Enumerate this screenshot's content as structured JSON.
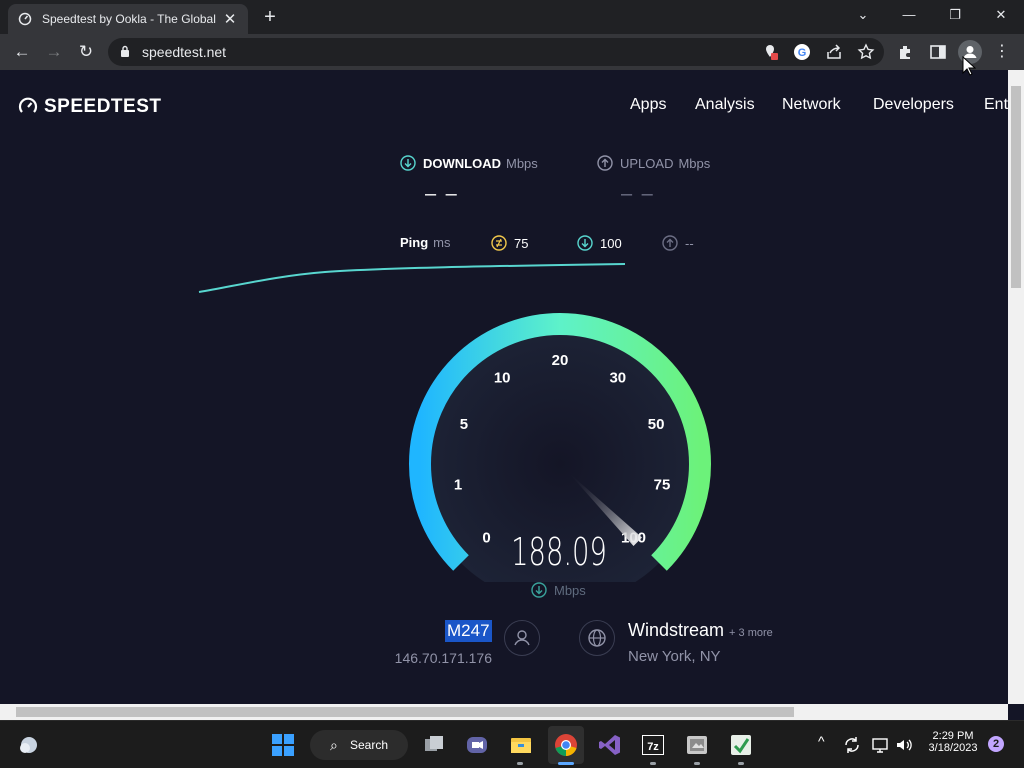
{
  "browser": {
    "tab_title": "Speedtest by Ookla - The Global",
    "url": "speedtest.net"
  },
  "site": {
    "logo_text": "SPEEDTEST",
    "nav": [
      "Apps",
      "Analysis",
      "Network",
      "Developers",
      "Ent"
    ]
  },
  "test": {
    "download_label": "DOWNLOAD",
    "upload_label": "UPLOAD",
    "unit": "Mbps",
    "download_value": "– –",
    "upload_value": "– –",
    "ping_label": "Ping",
    "ping_unit": "ms",
    "ping_idle": "75",
    "ping_down": "100",
    "ping_up": "--"
  },
  "gauge": {
    "ticks": [
      "0",
      "1",
      "5",
      "10",
      "20",
      "30",
      "50",
      "75",
      "100"
    ],
    "reading": "188.09",
    "unit": "Mbps",
    "level": 1.0
  },
  "client": {
    "name": "M247",
    "ip": "146.70.171.176"
  },
  "server": {
    "name": "Windstream",
    "more": "+ 3 more",
    "location": "New York, NY"
  },
  "taskbar": {
    "search_label": "Search",
    "time": "2:29 PM",
    "date": "3/18/2023",
    "notifications": "2"
  },
  "colors": {
    "background": "#141526",
    "gauge_start": "#1fb6ff",
    "gauge_end": "#6cf27a",
    "accent_teal": "#58d6cf"
  }
}
